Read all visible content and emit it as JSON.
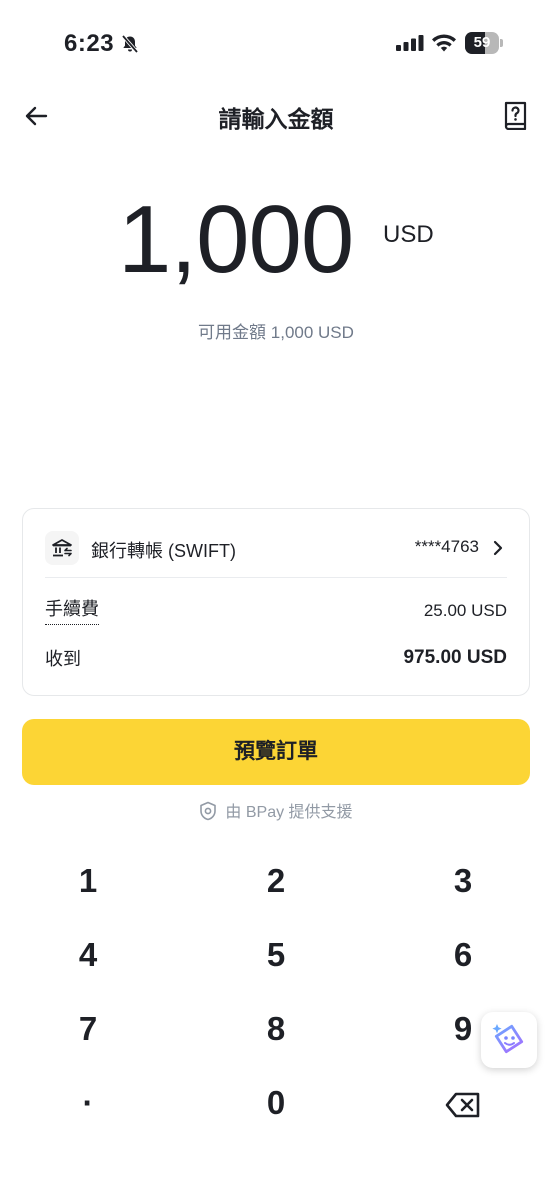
{
  "status_bar": {
    "time": "6:23",
    "battery": "59",
    "battery_level": 0.59
  },
  "header": {
    "title": "請輸入金額",
    "back_icon": "arrow-left-icon",
    "help_icon": "help-book-icon"
  },
  "amount": {
    "value": "1,000",
    "currency": "USD",
    "available": "可用金額 1,000 USD"
  },
  "payment_card": {
    "method_icon": "bank-icon",
    "method_label": "銀行轉帳 (SWIFT)",
    "account": "****4763",
    "fee_label": "手續費",
    "fee_value": "25.00 USD",
    "receive_label": "收到",
    "receive_value": "975.00 USD"
  },
  "preview_button": {
    "label": "預覽訂單"
  },
  "powered_by": "由 BPay 提供支援",
  "keypad": {
    "keys": [
      "1",
      "2",
      "3",
      "4",
      "5",
      "6",
      "7",
      "8",
      "9",
      "·",
      "0"
    ],
    "delete_icon": "backspace-icon"
  },
  "colors": {
    "accent": "#fcd535",
    "text": "#1e2026",
    "muted": "#707a8a"
  }
}
